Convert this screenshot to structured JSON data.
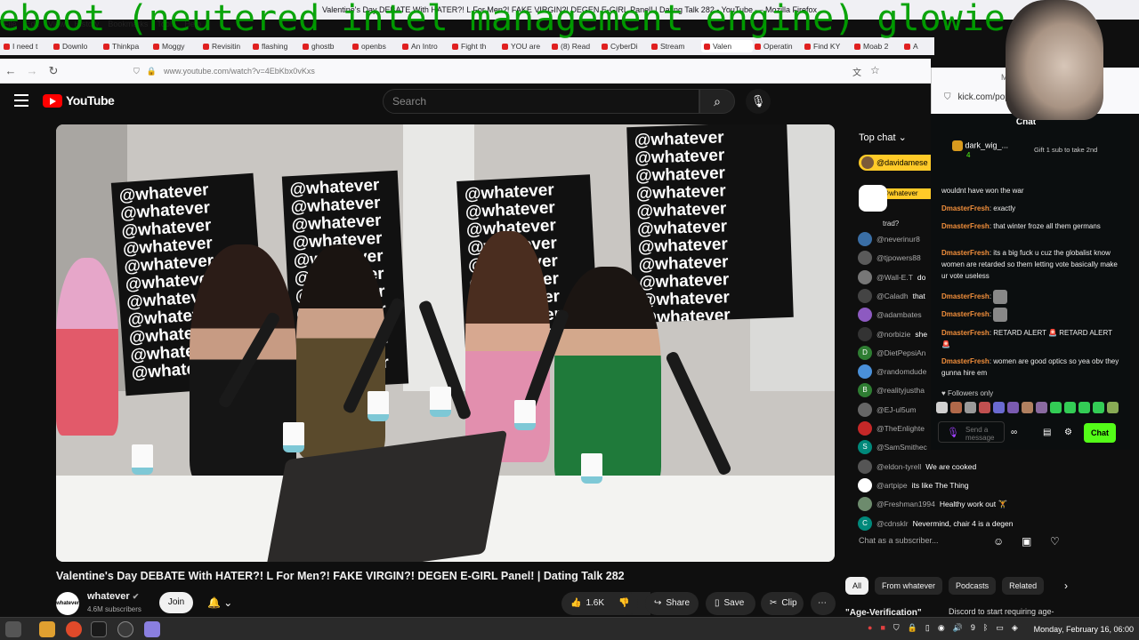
{
  "overlay": {
    "text": "eboot (neutered intel management engine) glowie"
  },
  "browser": {
    "window_title": "Valentine's Day DEBATE With HATER?! L For Men?! FAKE VIRGIN?! DEGEN E-GIRL Panel! | Dating Talk 282 - YouTube — Mozilla Firefox",
    "menu": [
      "File",
      "Edit",
      "View",
      "History",
      "Bookmarks",
      "Tools",
      "Help"
    ],
    "tabs": [
      "I need t",
      "Downlo",
      "Thinkpa",
      "Moggy",
      "Revisitin",
      "flashing",
      "ghostb",
      "openbs",
      "An Intro",
      "Fight th",
      "YOU are",
      "(8) Read",
      "CyberDi",
      "Stream",
      "Valen",
      "Operatin",
      "Find KY",
      "Moab 2",
      "A"
    ],
    "url": "www.youtube.com/watch?v=4EbKbx0vKxs",
    "second_window_title": "Mozi",
    "second_window_url": "kick.com/popou"
  },
  "youtube": {
    "logo": "YouTube",
    "search_placeholder": "Search",
    "video": {
      "banner_text": "@whatever",
      "title": "Valentine's Day DEBATE With HATER?! L For Men?! FAKE VIRGIN?! DEGEN E-GIRL Panel! | Dating Talk 282",
      "channel": "whatever",
      "channel_avatar": "whatever",
      "subscribers": "4.6M subscribers",
      "join": "Join",
      "likes": "1.6K",
      "share": "Share",
      "save": "Save",
      "clip": "Clip"
    },
    "chat": {
      "header": "Top chat",
      "pinned_donor": "@davidamese",
      "pinned_author": "@whatever",
      "partial_message": "trad?",
      "messages": [
        {
          "author": "@neverinur8",
          "text": "",
          "color": "#3a6ea5"
        },
        {
          "author": "@tjpowers88",
          "text": "",
          "color": "#5a5a5a"
        },
        {
          "author": "@Wall-E.T",
          "text": "do",
          "color": "#777777"
        },
        {
          "author": "@Caladh",
          "text": "that",
          "color": "#444444"
        },
        {
          "author": "@adambates",
          "text": "",
          "color": "#8d5ac1"
        },
        {
          "author": "@norbizie",
          "text": "she",
          "color": "#333333"
        },
        {
          "author": "@DietPepsiAn",
          "text": "",
          "color": "#2e7d32",
          "initial": "D"
        },
        {
          "author": "@randomdude",
          "text": "",
          "color": "#4a90d9"
        },
        {
          "author": "@realityjustha",
          "text": "",
          "color": "#2e7d32",
          "initial": "B"
        },
        {
          "author": "@EJ-ul5um",
          "text": "",
          "color": "#666666"
        },
        {
          "author": "@TheEnlighte",
          "text": "",
          "color": "#c62828"
        },
        {
          "author": "@SamSmithec",
          "text": "",
          "color": "#00897b",
          "initial": "S"
        },
        {
          "author": "@eldon-tyrell",
          "text": "We are cooked",
          "color": "#555555"
        },
        {
          "author": "@artpipe",
          "text": "its like The Thing",
          "color": "#ffffff"
        },
        {
          "author": "@Freshman1994",
          "text": "Healthy work out 🏋",
          "color": "#6d8b6d"
        },
        {
          "author": "@cdnsklr",
          "text": "Nevermind, chair 4 is a degen",
          "color": "#00897b",
          "initial": "C"
        }
      ],
      "input_placeholder": "Chat as a subscriber..."
    },
    "chips": [
      "All",
      "From whatever",
      "Podcasts",
      "Related"
    ],
    "recommendation": {
      "title": "\"Age-Verification\"",
      "desc": "Discord to start requiring age-"
    }
  },
  "kick": {
    "title": "Chat",
    "gift_user": "dark_wig_...",
    "gift_user_level": "4",
    "gift_text": "Gift 1 sub to take 2nd",
    "messages": [
      {
        "user": "",
        "text": "wouldnt have won the war"
      },
      {
        "user": "DmasterFresh",
        "text": "exactly"
      },
      {
        "user": "DmasterFresh",
        "text": "that winter froze all them germans"
      },
      {
        "user": "DmasterFresh",
        "text": "its a big fuck u cuz the globalist know women are retarded so them letting vote basically make ur vote useless"
      },
      {
        "user": "DmasterFresh",
        "text": ""
      },
      {
        "user": "DmasterFresh",
        "text": ""
      },
      {
        "user": "DmasterFresh",
        "text": "RETARD ALERT 🚨 RETARD ALERT 🚨"
      },
      {
        "user": "DmasterFresh",
        "text": "women are good optics so yea obv they gunna hire em"
      }
    ],
    "followers_only": "Followers only",
    "input_placeholder": "Send a message",
    "chat_button": "Chat"
  },
  "taskbar": {
    "clock": "Monday, February 16, 06:00",
    "volume": "9"
  }
}
